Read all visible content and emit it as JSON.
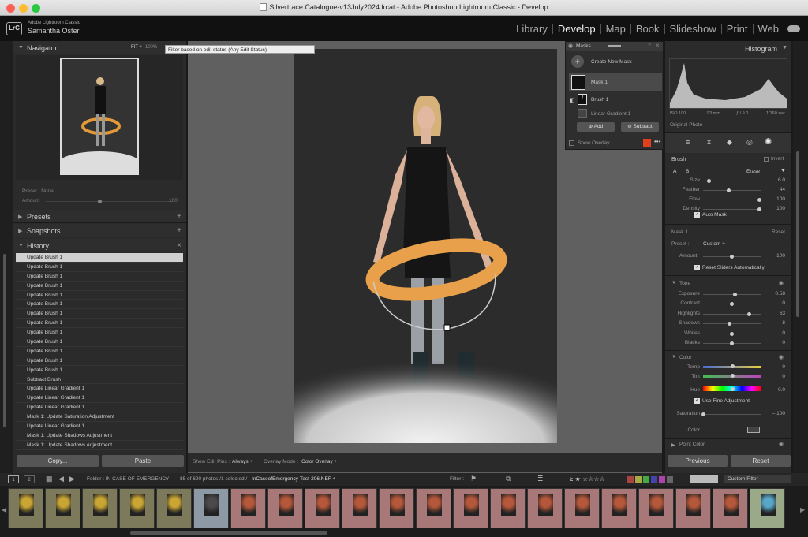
{
  "window": {
    "title": "Silvertrace Catalogue-v13July2024.lrcat - Adobe Photoshop Lightroom Classic - Develop"
  },
  "identity": {
    "badge": "LrC",
    "app": "Adobe Lightroom Classic",
    "user": "Samantha Oster"
  },
  "modules": [
    {
      "label": "Library"
    },
    {
      "label": "Develop",
      "active": true
    },
    {
      "label": "Map"
    },
    {
      "label": "Book"
    },
    {
      "label": "Slideshow"
    },
    {
      "label": "Print"
    },
    {
      "label": "Web"
    }
  ],
  "navigator": {
    "title": "Navigator",
    "fit": "FIT ÷",
    "zoom": "100%",
    "tooltip": "Filter based on edit status (Any Edit Status)"
  },
  "preset": {
    "label": "Preset : None",
    "amount_label": "Amount",
    "amount_value": "100"
  },
  "panels": {
    "presets": "Presets",
    "snapshots": "Snapshots",
    "history": "History"
  },
  "history": [
    "Update Brush 1",
    "Update Brush 1",
    "Update Brush 1",
    "Update Brush 1",
    "Update Brush 1",
    "Update Brush 1",
    "Update Brush 1",
    "Update Brush 1",
    "Update Brush 1",
    "Update Brush 1",
    "Update Brush 1",
    "Update Brush 1",
    "Update Brush 1",
    "Subtract Brush",
    "Update Linear Gradient 1",
    "Update Linear Gradient 1",
    "Update Linear Gradient 1",
    "Mask 1: Update Saturation Adjustment",
    "Update Linear Gradient 1",
    "Mask 1: Update Shadows Adjustment",
    "Mask 1: Update Shadows Adjustment"
  ],
  "left_buttons": {
    "copy": "Copy...",
    "paste": "Paste"
  },
  "toolbar": {
    "edit_pins_label": "Show Edit Pins :",
    "edit_pins_value": "Always ÷",
    "overlay_label": "Overlay Mode :",
    "overlay_value": "Color Overlay ÷"
  },
  "masks": {
    "title": "Masks",
    "create": "Create New Mask",
    "mask1": "Mask 1",
    "brush1": "Brush 1",
    "gradient": "Linear Gradient 1",
    "add": "Add",
    "subtract": "Subtract",
    "show_overlay": "Show Overlay"
  },
  "histogram": {
    "title": "Histogram",
    "iso": "ISO 100",
    "focal": "93 mm",
    "aperture": "ƒ / 9.0",
    "shutter": "1/160 sec",
    "original": "Original Photo"
  },
  "brush": {
    "title": "Brush",
    "invert": "Invert",
    "a": "A",
    "b": "B",
    "erase": "Erase",
    "sliders": [
      {
        "label": "Size",
        "value": "6.0",
        "pos": 0.1
      },
      {
        "label": "Feather",
        "value": "44",
        "pos": 0.44
      },
      {
        "label": "Flow",
        "value": "100",
        "pos": 0.98
      },
      {
        "label": "Density",
        "value": "100",
        "pos": 0.98
      }
    ],
    "auto_mask": "Auto Mask"
  },
  "mask_section": {
    "title": "Mask 1",
    "reset": "Reset",
    "preset_label": "Preset :",
    "preset_value": "Custom ÷",
    "amount_label": "Amount",
    "amount_value": "100",
    "amount_pos": 0.5,
    "reset_auto": "Reset Sliders Automatically"
  },
  "tone": {
    "title": "Tone",
    "sliders": [
      {
        "label": "Exposure",
        "value": "0.58",
        "pos": 0.55
      },
      {
        "label": "Contrast",
        "value": "0",
        "pos": 0.5
      },
      {
        "label": "Highlights",
        "value": "63",
        "pos": 0.81
      },
      {
        "label": "Shadows",
        "value": "– 8",
        "pos": 0.46
      },
      {
        "label": "Whites",
        "value": "0",
        "pos": 0.5
      },
      {
        "label": "Blacks",
        "value": "0",
        "pos": 0.5
      }
    ]
  },
  "color": {
    "title": "Color",
    "temp": "Temp",
    "temp_value": "0",
    "tint": "Tint",
    "tint_value": "0",
    "hue": "Hue",
    "hue_value": "0.0",
    "fine": "Use Fine Adjustment",
    "sat": "Saturation",
    "sat_value": "– 100",
    "sat_pos": 0.0,
    "color_label": "Color"
  },
  "point_color": "Point Color",
  "right_buttons": {
    "previous": "Previous",
    "reset": "Reset"
  },
  "filmbar": {
    "page1": "1",
    "page2": "2",
    "folder": "Folder : IN CASE OF EMERGENCY",
    "count": "85 of 620 photos /1 selected /",
    "file": "InCaseofEmergency-Test-206.NEF ÷",
    "filter": "Filter :",
    "custom_filter": "Custom Filter"
  },
  "colors": {
    "accent_selected": "#d0d0d0",
    "panel_bg": "#2b2b2b",
    "overlay_swatch": "#e0401e"
  }
}
